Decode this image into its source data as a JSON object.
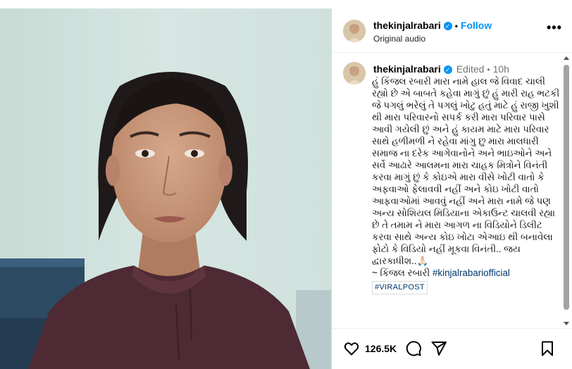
{
  "post": {
    "username": "thekinjalrabari",
    "dot": "•",
    "follow_label": "Follow",
    "audio": "Original audio",
    "more_label": "•••"
  },
  "caption": {
    "username": "thekinjalrabari",
    "edited": "Edited",
    "dot": "•",
    "time": "10h",
    "body": "હું કિંજલ રબારી મારા નામે હાલ જે વિવાદ ચાલી રહ્યો છે એ બાબતે કહેવા માગું છું હું મારી રાહ ભટકી જે પગલું ભરેલું તે પગલું ખોટુ હતું માટે હું રાજી ખુશી થી મારા પરિવારનો સપર્ક કરી મારા પરિવાર પાસે આવી ગયેલી છું અને હું કાયમ માટે મારા પરિવાર સાથે હળીમળી ને રહેવા માંગુ છુ મારા માલધારી સમાજ ના દરેક આગેવાનોને અને ભાઇઓને અને સર્વે આઢારે આલમના મારા ચાહક મિત્રોને વિનંતી કરવા માગું છું કે કોઇએ મારા વીસે ખોટી વાતો કે અફવાઓ ફેલાવવી નહીં અને કોઇ ખોટી વાતો આફવાઓમાં આવવું નહીં અને મારા નામે જે પણ અન્ય સોશિયલ મિડિયાના એકાઉન્ટ ચાલવી રહ્યા છે તે તમામ ને મારા આગળ ના વિડિયોને ડિલીટ કરવા સાથે અન્ય કોઇ ખોટા એઆઇ થી બનાવેલા ફોટો કે વિડિયો નહીં મૂકવા વિનંતી.. જય દ્વારકાધીશ..🙏🏻",
    "signature": "~ કિંજલ રબારી",
    "hashtag": "#kinjalrabariofficial",
    "tag": "#VIRALPOST"
  },
  "actions": {
    "likes": "126.5K"
  },
  "colors": {
    "accent": "#0095f6",
    "hashtag": "#00376b",
    "muted": "#737373"
  }
}
